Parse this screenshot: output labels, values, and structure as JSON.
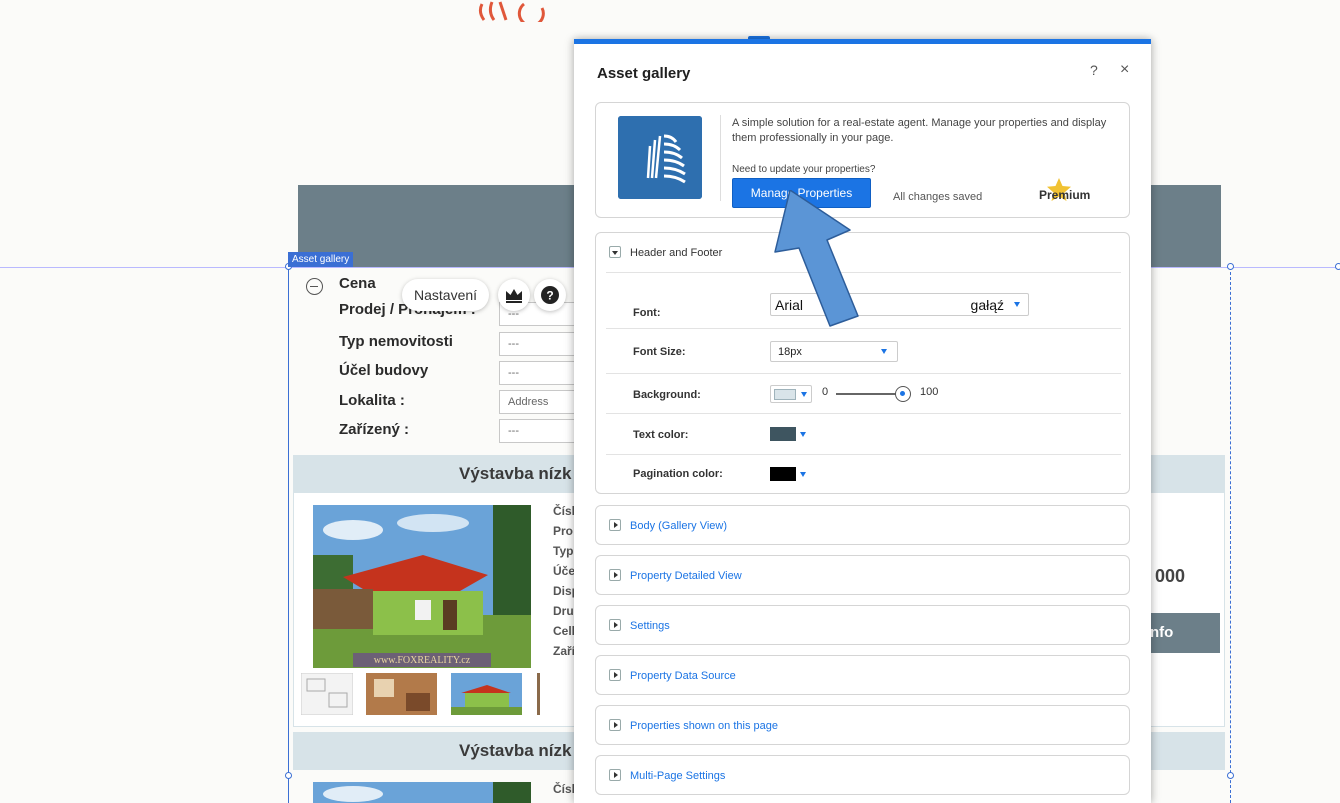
{
  "background_page": {
    "selection_tag": "Asset gallery",
    "filters": [
      {
        "label": "Cena"
      },
      {
        "label": "Prodej / Pronájem :",
        "value": "---"
      },
      {
        "label": "Typ nemovitosti",
        "value": "---"
      },
      {
        "label": "Účel budovy",
        "value": "---"
      },
      {
        "label": "Lokalita :",
        "placeholder": "Address"
      },
      {
        "label": "Zařízený :",
        "value": "---"
      }
    ],
    "toolbar": {
      "settings_label": "Nastavení",
      "crown_icon": "crown-icon",
      "help_icon": "help-icon"
    },
    "listing_title": "Výstavba nízk",
    "listing_title_2": "Výstavba nízk",
    "detail_labels": [
      "Čísl",
      "Pro",
      "Typ",
      "Úče",
      "Disp",
      "Dru",
      "Cell",
      "Zaří"
    ],
    "detail_labels_2": [
      "Čísl"
    ],
    "photo_watermark": "www.FOXREALITY.cz",
    "price_fragment": "0 000",
    "info_button_fragment": "nfo"
  },
  "dialog": {
    "title": "Asset gallery",
    "help_label": "?",
    "close_label": "×",
    "app": {
      "description": "A simple solution for a real-estate agent. Manage your properties and display them professionally in your page.",
      "need_update": "Need to update your properties?",
      "manage_button": "Manage Properties",
      "saved_status": "All changes saved",
      "premium_label": "Premium"
    },
    "header_footer": {
      "title": "Header and Footer",
      "font_label": "Font:",
      "font_value": "Arial",
      "font_extra": "gałąź",
      "font_size_label": "Font Size:",
      "font_size_value": "18px",
      "background_label": "Background:",
      "background_slider_min": "0",
      "background_slider_max": "100",
      "text_color_label": "Text color:",
      "pagination_color_label": "Pagination color:"
    },
    "sections": [
      "Body (Gallery View)",
      "Property Detailed View",
      "Settings",
      "Property Data Source",
      "Properties shown on this page",
      "Multi-Page Settings"
    ]
  },
  "colors": {
    "accent": "#1b74e4",
    "header_bg": "#6c7f89",
    "background_swatch": "#d9e4e9",
    "text_color_swatch": "#3e5560",
    "pagination_color_swatch": "#000000",
    "annotation_arrow": "#5b95d6"
  }
}
